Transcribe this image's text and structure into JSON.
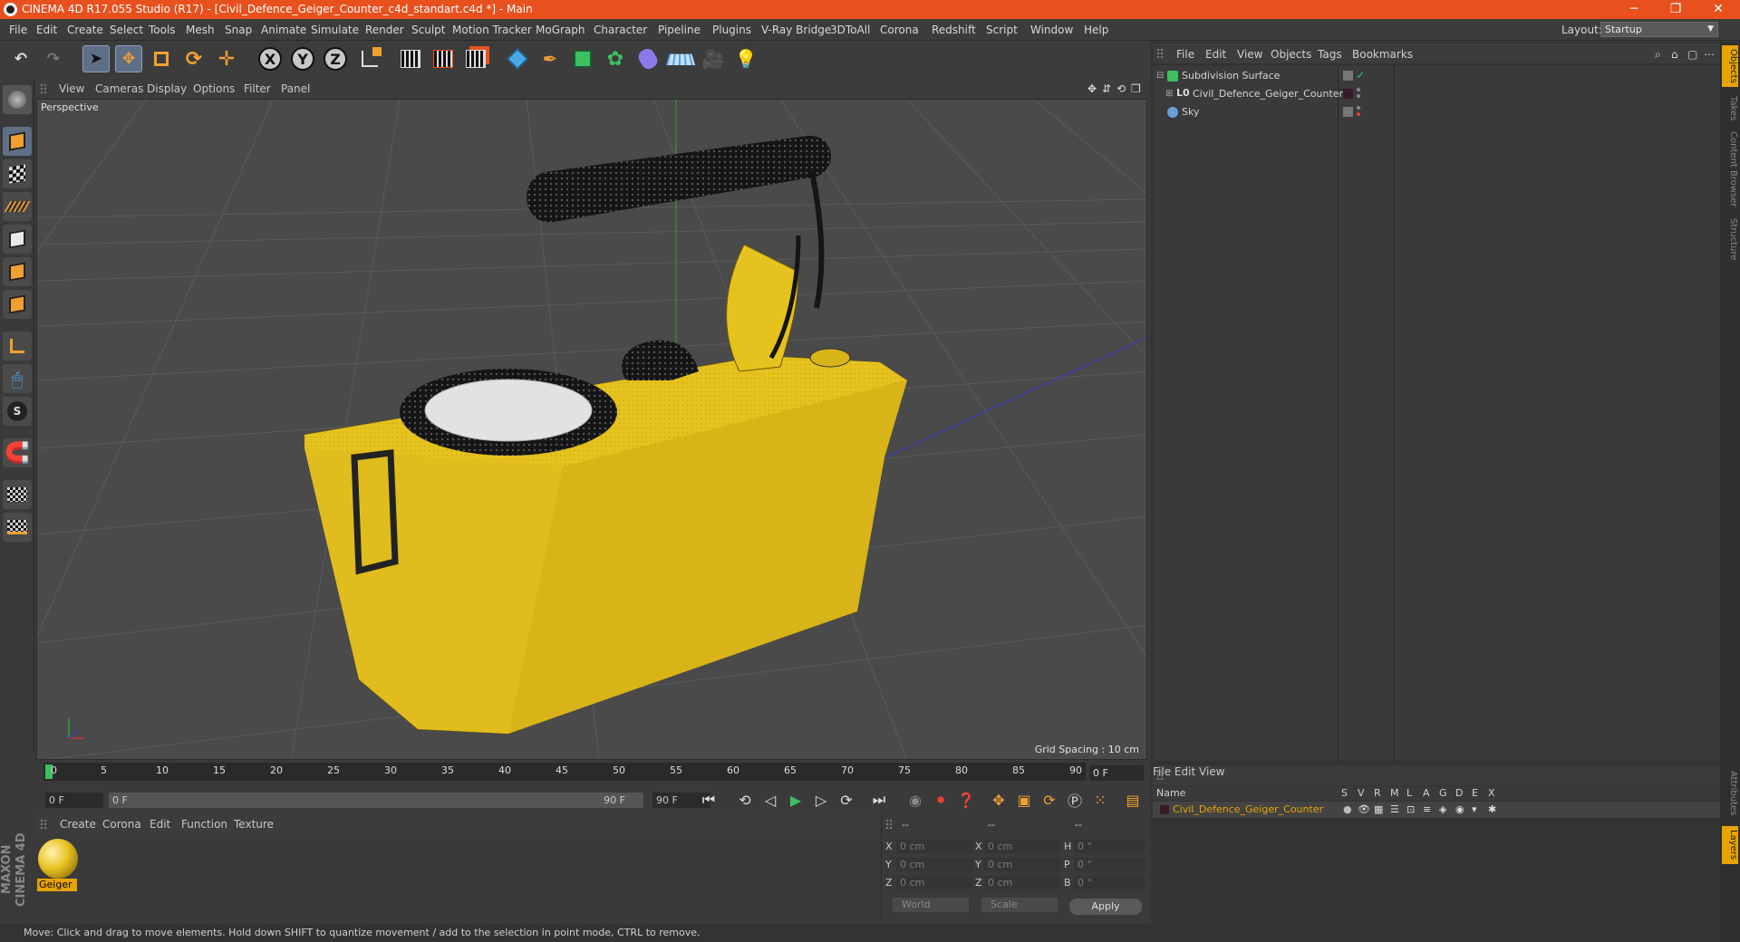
{
  "window": {
    "title": "CINEMA 4D R17.055 Studio (R17) - [Civil_Defence_Geiger_Counter_c4d_standart.c4d *] - Main",
    "controls": [
      "─",
      "❐",
      "✕"
    ]
  },
  "menubar": {
    "items": [
      "File",
      "Edit",
      "Create",
      "Select",
      "Tools",
      "Mesh",
      "Snap",
      "Animate",
      "Simulate",
      "Render",
      "Sculpt",
      "Motion Tracker",
      "MoGraph",
      "Character",
      "Pipeline",
      "Plugins",
      "V-Ray Bridge",
      "3DToAll",
      "Corona",
      "Redshift",
      "Script",
      "Window",
      "Help"
    ],
    "layout_label": "Layout:",
    "layout_value": "Startup"
  },
  "toolbar": {
    "axis_labels": [
      "X",
      "Y",
      "Z"
    ],
    "icons": [
      "undo-icon",
      "redo-icon",
      "select-arrow-icon",
      "move-icon",
      "scale-icon",
      "rotate-icon",
      "move-plus-icon",
      "x-axis-icon",
      "y-axis-icon",
      "z-axis-icon",
      "coordinate-system-icon",
      "render-view-icon",
      "render-picture-viewer-icon",
      "render-settings-icon",
      "cube-icon",
      "pen-spline-icon",
      "subdivision-icon",
      "cloner-icon",
      "deformer-icon",
      "floor-icon",
      "camera-icon",
      "light-icon"
    ]
  },
  "viewport": {
    "menu": [
      "View",
      "Cameras",
      "Display",
      "Options",
      "Filter",
      "Panel"
    ],
    "label": "Perspective",
    "grid_spacing": "Grid Spacing : 10 cm"
  },
  "timeline": {
    "ticks": [
      "0",
      "5",
      "10",
      "15",
      "20",
      "25",
      "30",
      "35",
      "40",
      "45",
      "50",
      "55",
      "60",
      "65",
      "70",
      "75",
      "80",
      "85",
      "90"
    ],
    "current_frame": "0 F",
    "start_field": "0 F",
    "range_start": "0 F",
    "range_end": "90 F",
    "end_field": "90 F"
  },
  "materials": {
    "menu": [
      "Create",
      "Corona",
      "Edit",
      "Function",
      "Texture"
    ],
    "items": [
      {
        "name": "Geiger",
        "color": "#e8c020"
      }
    ]
  },
  "coordinates": {
    "header": [
      "--",
      "--",
      "--"
    ],
    "rows": [
      {
        "l1": "X",
        "v1": "0 cm",
        "l2": "X",
        "v2": "0 cm",
        "l3": "H",
        "v3": "0 °"
      },
      {
        "l1": "Y",
        "v1": "0 cm",
        "l2": "Y",
        "v2": "0 cm",
        "l3": "P",
        "v3": "0 °"
      },
      {
        "l1": "Z",
        "v1": "0 cm",
        "l2": "Z",
        "v2": "0 cm",
        "l3": "B",
        "v3": "0 °"
      }
    ],
    "mode1": "World",
    "mode2": "Scale",
    "apply": "Apply"
  },
  "status": "Move: Click and drag to move elements. Hold down SHIFT to quantize movement / add to the selection in point mode, CTRL to remove.",
  "branding": "MAXON CINEMA 4D",
  "objects": {
    "menu": [
      "File",
      "Edit",
      "View",
      "Objects",
      "Tags",
      "Bookmarks"
    ],
    "tree": [
      {
        "name": "Subdivision Surface",
        "icon": "subdivision-surface-icon",
        "indent": 0
      },
      {
        "name": "Civil_Defence_Geiger_Counter",
        "icon": "null-object-icon",
        "indent": 1
      },
      {
        "name": "Sky",
        "icon": "sky-icon",
        "indent": 0
      }
    ]
  },
  "layers": {
    "menu": [
      "File",
      "Edit",
      "View"
    ],
    "headers": [
      "Name",
      "S",
      "V",
      "R",
      "M",
      "L",
      "A",
      "G",
      "D",
      "E",
      "X"
    ],
    "rows": [
      {
        "name": "Civil_Defence_Geiger_Counter",
        "color": "#e8a400"
      }
    ]
  },
  "right_tabs": [
    "Objects",
    "Takes",
    "Content Browser",
    "Structure",
    "Attributes",
    "Layers"
  ],
  "colors": {
    "title_bar": "#e8501e",
    "accent": "#e8a400",
    "grid_bg": "#4a4a4a",
    "model_yellow": "#e8c020"
  }
}
